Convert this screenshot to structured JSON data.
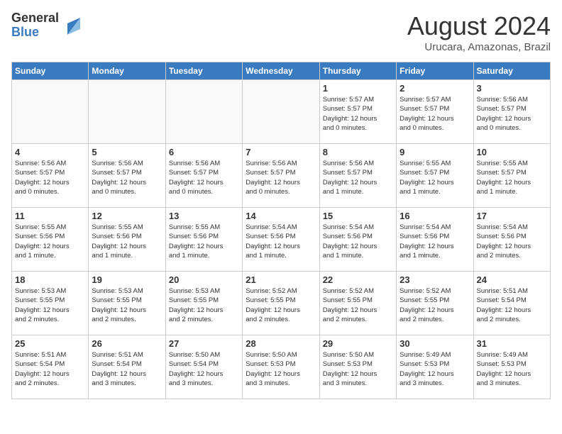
{
  "header": {
    "logo_general": "General",
    "logo_blue": "Blue",
    "month_year": "August 2024",
    "location": "Urucara, Amazonas, Brazil"
  },
  "weekdays": [
    "Sunday",
    "Monday",
    "Tuesday",
    "Wednesday",
    "Thursday",
    "Friday",
    "Saturday"
  ],
  "weeks": [
    [
      {
        "day": "",
        "info": ""
      },
      {
        "day": "",
        "info": ""
      },
      {
        "day": "",
        "info": ""
      },
      {
        "day": "",
        "info": ""
      },
      {
        "day": "1",
        "info": "Sunrise: 5:57 AM\nSunset: 5:57 PM\nDaylight: 12 hours\nand 0 minutes."
      },
      {
        "day": "2",
        "info": "Sunrise: 5:57 AM\nSunset: 5:57 PM\nDaylight: 12 hours\nand 0 minutes."
      },
      {
        "day": "3",
        "info": "Sunrise: 5:56 AM\nSunset: 5:57 PM\nDaylight: 12 hours\nand 0 minutes."
      }
    ],
    [
      {
        "day": "4",
        "info": "Sunrise: 5:56 AM\nSunset: 5:57 PM\nDaylight: 12 hours\nand 0 minutes."
      },
      {
        "day": "5",
        "info": "Sunrise: 5:56 AM\nSunset: 5:57 PM\nDaylight: 12 hours\nand 0 minutes."
      },
      {
        "day": "6",
        "info": "Sunrise: 5:56 AM\nSunset: 5:57 PM\nDaylight: 12 hours\nand 0 minutes."
      },
      {
        "day": "7",
        "info": "Sunrise: 5:56 AM\nSunset: 5:57 PM\nDaylight: 12 hours\nand 0 minutes."
      },
      {
        "day": "8",
        "info": "Sunrise: 5:56 AM\nSunset: 5:57 PM\nDaylight: 12 hours\nand 1 minute."
      },
      {
        "day": "9",
        "info": "Sunrise: 5:55 AM\nSunset: 5:57 PM\nDaylight: 12 hours\nand 1 minute."
      },
      {
        "day": "10",
        "info": "Sunrise: 5:55 AM\nSunset: 5:57 PM\nDaylight: 12 hours\nand 1 minute."
      }
    ],
    [
      {
        "day": "11",
        "info": "Sunrise: 5:55 AM\nSunset: 5:56 PM\nDaylight: 12 hours\nand 1 minute."
      },
      {
        "day": "12",
        "info": "Sunrise: 5:55 AM\nSunset: 5:56 PM\nDaylight: 12 hours\nand 1 minute."
      },
      {
        "day": "13",
        "info": "Sunrise: 5:55 AM\nSunset: 5:56 PM\nDaylight: 12 hours\nand 1 minute."
      },
      {
        "day": "14",
        "info": "Sunrise: 5:54 AM\nSunset: 5:56 PM\nDaylight: 12 hours\nand 1 minute."
      },
      {
        "day": "15",
        "info": "Sunrise: 5:54 AM\nSunset: 5:56 PM\nDaylight: 12 hours\nand 1 minute."
      },
      {
        "day": "16",
        "info": "Sunrise: 5:54 AM\nSunset: 5:56 PM\nDaylight: 12 hours\nand 1 minute."
      },
      {
        "day": "17",
        "info": "Sunrise: 5:54 AM\nSunset: 5:56 PM\nDaylight: 12 hours\nand 2 minutes."
      }
    ],
    [
      {
        "day": "18",
        "info": "Sunrise: 5:53 AM\nSunset: 5:55 PM\nDaylight: 12 hours\nand 2 minutes."
      },
      {
        "day": "19",
        "info": "Sunrise: 5:53 AM\nSunset: 5:55 PM\nDaylight: 12 hours\nand 2 minutes."
      },
      {
        "day": "20",
        "info": "Sunrise: 5:53 AM\nSunset: 5:55 PM\nDaylight: 12 hours\nand 2 minutes."
      },
      {
        "day": "21",
        "info": "Sunrise: 5:52 AM\nSunset: 5:55 PM\nDaylight: 12 hours\nand 2 minutes."
      },
      {
        "day": "22",
        "info": "Sunrise: 5:52 AM\nSunset: 5:55 PM\nDaylight: 12 hours\nand 2 minutes."
      },
      {
        "day": "23",
        "info": "Sunrise: 5:52 AM\nSunset: 5:55 PM\nDaylight: 12 hours\nand 2 minutes."
      },
      {
        "day": "24",
        "info": "Sunrise: 5:51 AM\nSunset: 5:54 PM\nDaylight: 12 hours\nand 2 minutes."
      }
    ],
    [
      {
        "day": "25",
        "info": "Sunrise: 5:51 AM\nSunset: 5:54 PM\nDaylight: 12 hours\nand 2 minutes."
      },
      {
        "day": "26",
        "info": "Sunrise: 5:51 AM\nSunset: 5:54 PM\nDaylight: 12 hours\nand 3 minutes."
      },
      {
        "day": "27",
        "info": "Sunrise: 5:50 AM\nSunset: 5:54 PM\nDaylight: 12 hours\nand 3 minutes."
      },
      {
        "day": "28",
        "info": "Sunrise: 5:50 AM\nSunset: 5:53 PM\nDaylight: 12 hours\nand 3 minutes."
      },
      {
        "day": "29",
        "info": "Sunrise: 5:50 AM\nSunset: 5:53 PM\nDaylight: 12 hours\nand 3 minutes."
      },
      {
        "day": "30",
        "info": "Sunrise: 5:49 AM\nSunset: 5:53 PM\nDaylight: 12 hours\nand 3 minutes."
      },
      {
        "day": "31",
        "info": "Sunrise: 5:49 AM\nSunset: 5:53 PM\nDaylight: 12 hours\nand 3 minutes."
      }
    ]
  ]
}
